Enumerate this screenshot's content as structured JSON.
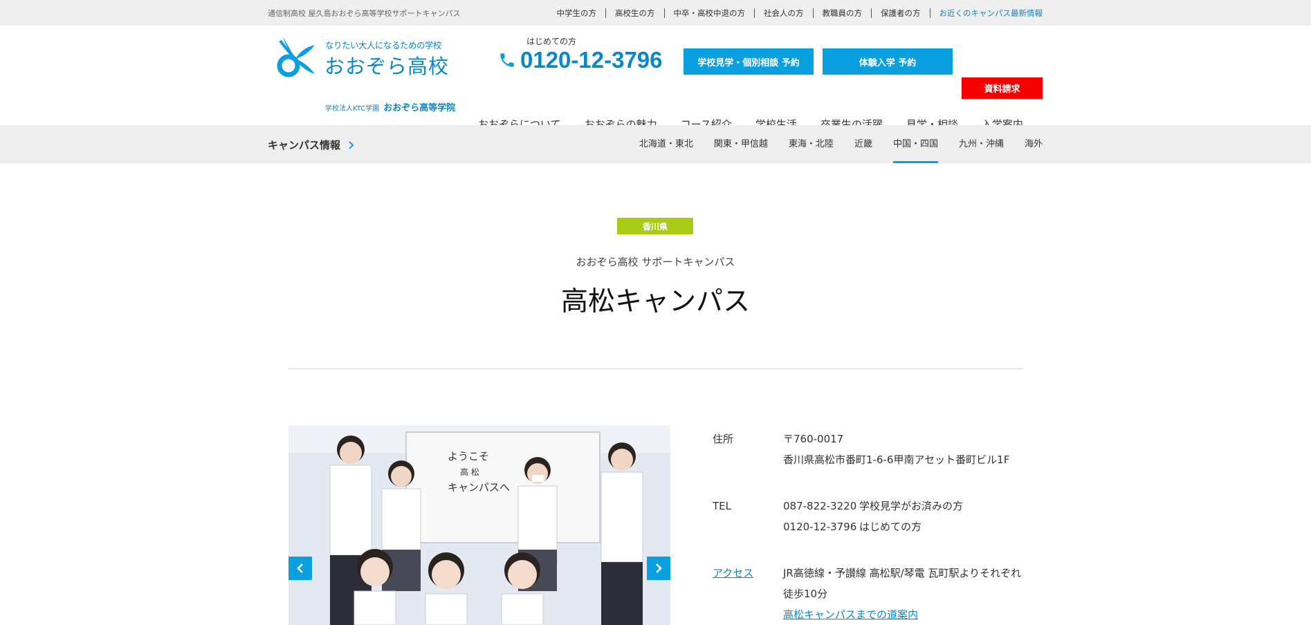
{
  "topbar": {
    "site_desc": "通信制高校 屋久島おおぞら高等学校サポートキャンパス",
    "links": [
      "中学生の方",
      "高校生の方",
      "中卒・高校中退の方",
      "社会人の方",
      "教職員の方",
      "保護者の方",
      "お近くのキャンパス最新情報"
    ]
  },
  "header": {
    "logo_catch": "なりたい大人になるための学校",
    "logo_name": "おおぞら高校",
    "logo_sub_corp": "学校法人KTC学園",
    "logo_sub_name": "おおぞら高等学院",
    "phone_label": "はじめての方",
    "phone_number": "0120-12-3796",
    "btn_visit": "学校見学・個別相談 予約",
    "btn_trial": "体験入学 予約",
    "btn_doc": "資料請求",
    "gnav": [
      "おおぞらについて",
      "おおぞらの魅力",
      "コース紹介",
      "学校生活",
      "卒業生の活躍",
      "見学・相談",
      "入学案内"
    ]
  },
  "campus_nav": {
    "title": "キャンパス情報",
    "regions": [
      "北海道・東北",
      "関東・甲信越",
      "東海・北陸",
      "近畿",
      "中国・四国",
      "九州・沖縄",
      "海外"
    ],
    "active_region": "中国・四国"
  },
  "main": {
    "prefecture": "香川県",
    "subtitle": "おおぞら高校 サポートキャンパス",
    "title": "高松キャンパス"
  },
  "info": {
    "address_label": "住所",
    "postal": "〒760-0017",
    "address": "香川県高松市番町1-6-6甲南アセット番町ビル1F",
    "tel_label": "TEL",
    "tel1": "087-822-3220",
    "tel1_note": "学校見学がお済みの方",
    "tel2": "0120-12-3796",
    "tel2_note": "はじめての方",
    "access_label": "アクセス",
    "access_text": "JR高徳線・予讃線 高松駅/琴電 瓦町駅よりそれぞれ徒歩10分",
    "access_link": "高松キャンパスまでの道案内"
  },
  "colors": {
    "brand_blue": "#0aa0e0",
    "link_blue": "#0a87c6",
    "doc_red": "#f30000",
    "badge_green": "#a9cc18"
  },
  "slider": {
    "photo_whiteboard_line1": "ようこそ",
    "photo_whiteboard_line2": "高 松",
    "photo_whiteboard_line3": "キャンパスへ"
  }
}
